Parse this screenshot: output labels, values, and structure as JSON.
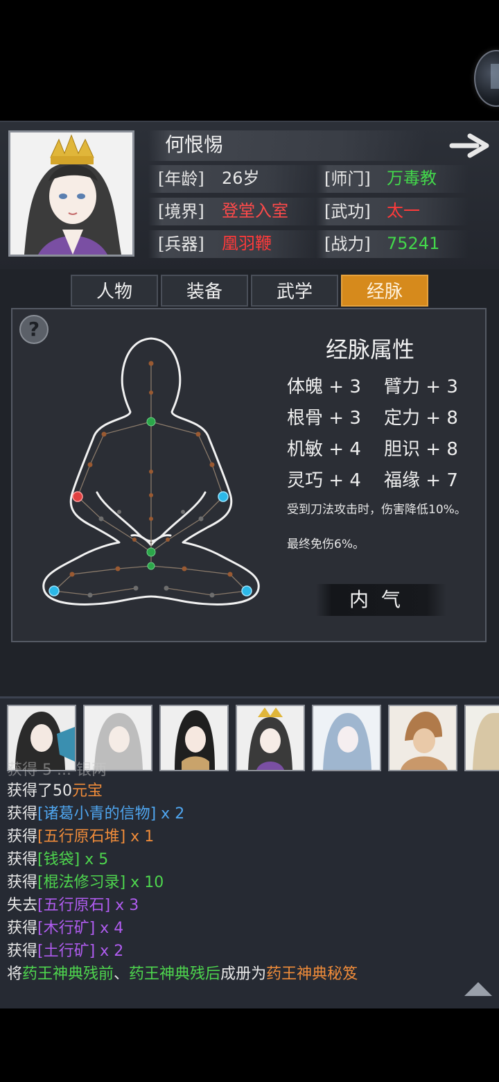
{
  "character": {
    "name": "何恨惕",
    "rows": [
      {
        "label": "[年龄]",
        "value": "26岁",
        "color": "#e8e8e8"
      },
      {
        "label": "[境界]",
        "value": "登堂入室",
        "color": "#ff4a4a"
      },
      {
        "label": "[兵器]",
        "value": "凰羽鞭",
        "color": "#ff3a3a"
      }
    ],
    "rows_right": [
      {
        "label": "[师门]",
        "value": "万毒教",
        "color": "#43d84b"
      },
      {
        "label": "[武功]",
        "value": "太一",
        "color": "#ff3a3a"
      },
      {
        "label": "[战力]",
        "value": "75241",
        "color": "#43d84b"
      }
    ]
  },
  "tabs": [
    {
      "label": "人物",
      "active": false
    },
    {
      "label": "装备",
      "active": false
    },
    {
      "label": "武学",
      "active": false
    },
    {
      "label": "经脉",
      "active": true
    }
  ],
  "meridian": {
    "help_glyph": "?",
    "title": "经脉属性",
    "attributes": [
      [
        "体魄 + 3",
        "臂力 + 3"
      ],
      [
        "根骨 + 3",
        "定力 + 8"
      ],
      [
        "机敏 + 4",
        "胆识 + 8"
      ],
      [
        "灵巧 + 4",
        "福缘 + 7"
      ]
    ],
    "note1": "受到刀法攻击时，伤害降低10%。",
    "note2": "最终免伤6%。",
    "inner_qi_label": "内气"
  },
  "team_count": 7,
  "log": {
    "clipped_line": "获得 5 ... 银两",
    "lines": [
      [
        {
          "t": "获得了50",
          "c": "#e8e8e8"
        },
        {
          "t": "元宝",
          "c": "#f08c3a"
        }
      ],
      [
        {
          "t": "获得",
          "c": "#e8e8e8"
        },
        {
          "t": "[诸葛小青的信物]",
          "c": "#4fa6f0"
        },
        {
          "t": " x 2",
          "c": "#4fa6f0"
        }
      ],
      [
        {
          "t": "获得",
          "c": "#e8e8e8"
        },
        {
          "t": "[五行原石堆]",
          "c": "#f08c3a"
        },
        {
          "t": " x 1",
          "c": "#f08c3a"
        }
      ],
      [
        {
          "t": "获得",
          "c": "#e8e8e8"
        },
        {
          "t": "[钱袋]",
          "c": "#4ed64e"
        },
        {
          "t": " x 5",
          "c": "#4ed64e"
        }
      ],
      [
        {
          "t": "获得",
          "c": "#e8e8e8"
        },
        {
          "t": "[棍法修习录]",
          "c": "#4ed64e"
        },
        {
          "t": " x 10",
          "c": "#4ed64e"
        }
      ],
      [
        {
          "t": "失去",
          "c": "#e8e8e8"
        },
        {
          "t": "[五行原石]",
          "c": "#b05cf0"
        },
        {
          "t": " x 3",
          "c": "#b05cf0"
        }
      ],
      [
        {
          "t": "获得",
          "c": "#e8e8e8"
        },
        {
          "t": "[木行矿]",
          "c": "#b05cf0"
        },
        {
          "t": " x 4",
          "c": "#b05cf0"
        }
      ],
      [
        {
          "t": "获得",
          "c": "#e8e8e8"
        },
        {
          "t": "[土行矿]",
          "c": "#b05cf0"
        },
        {
          "t": " x 2",
          "c": "#b05cf0"
        }
      ],
      [
        {
          "t": "将",
          "c": "#e8e8e8"
        },
        {
          "t": "药王神典残前",
          "c": "#4ed64e"
        },
        {
          "t": "、",
          "c": "#e8e8e8"
        },
        {
          "t": "药王神典残后",
          "c": "#4ed64e"
        },
        {
          "t": "成册为",
          "c": "#e8e8e8"
        },
        {
          "t": "药王神典秘笈",
          "c": "#f08c3a"
        }
      ]
    ]
  },
  "icons": {
    "next": "arrow-right-icon",
    "scroll": "triangle-up-icon",
    "help": "question-icon"
  }
}
